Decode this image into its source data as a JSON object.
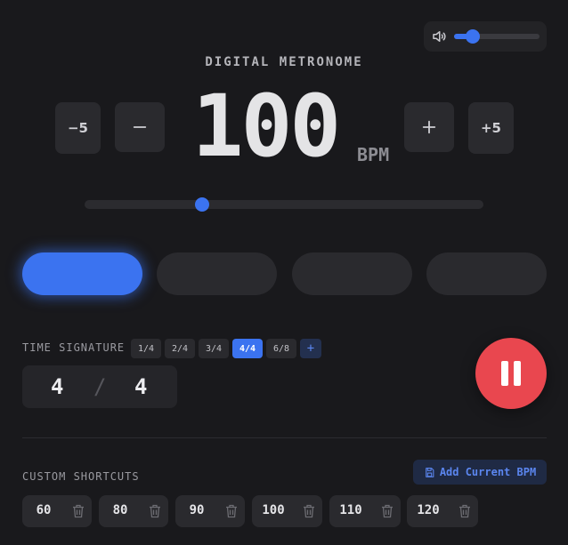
{
  "header": {
    "title": "DIGITAL METRONOME"
  },
  "volume": {
    "level": 0.22,
    "icon": "volume-icon"
  },
  "tempo": {
    "bpm": "100",
    "unit": "BPM",
    "minus5_label": "−5",
    "plus5_label": "+5",
    "slider_fraction": 0.295
  },
  "beats": {
    "count": 4,
    "active_index": 0
  },
  "time_signature": {
    "label": "TIME SIGNATURE",
    "options": [
      "1/4",
      "2/4",
      "3/4",
      "4/4",
      "6/8"
    ],
    "selected": "4/4",
    "add_label": "+",
    "numerator": "4",
    "slash": "/",
    "denominator": "4"
  },
  "shortcuts": {
    "label": "CUSTOM SHORTCUTS",
    "add_button": "Add Current BPM",
    "values": [
      "60",
      "80",
      "90",
      "100",
      "110",
      "120"
    ]
  },
  "colors": {
    "accent": "#3b73f0",
    "play": "#e9474f",
    "background": "#19191c"
  }
}
